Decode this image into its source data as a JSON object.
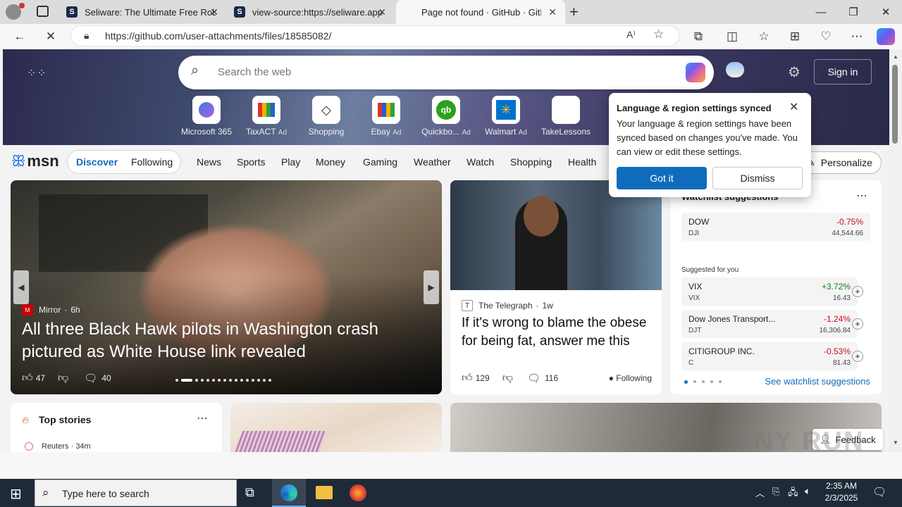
{
  "tabs": [
    {
      "title": "Seliware: The Ultimate Free Roblo",
      "favicon": "S"
    },
    {
      "title": "view-source:https://seliware.app",
      "favicon": "S"
    },
    {
      "title": "Page not found · GitHub · GitHub",
      "favicon": ""
    }
  ],
  "address": {
    "url": "https://github.com/user-attachments/files/18585082/"
  },
  "search": {
    "placeholder": "Search the web"
  },
  "signin": "Sign in",
  "quicklinks": [
    {
      "label": "Microsoft 365",
      "ad": "",
      "icon": "m365-icon"
    },
    {
      "label": "TaxACT",
      "ad": "Ad",
      "icon": "taxact-icon"
    },
    {
      "label": "Shopping",
      "ad": "",
      "icon": "tag-icon"
    },
    {
      "label": "Ebay",
      "ad": "Ad",
      "icon": "ebay-icon"
    },
    {
      "label": "Quickbo...",
      "ad": "Ad",
      "icon": "quickbooks-icon"
    },
    {
      "label": "Walmart",
      "ad": "Ad",
      "icon": "walmart-icon"
    },
    {
      "label": "TakeLessons",
      "ad": "",
      "icon": "takelessons-icon"
    }
  ],
  "nav": {
    "logo": "msn",
    "discover": "Discover",
    "following": "Following",
    "items": [
      "News",
      "Sports",
      "Play",
      "Money",
      "Gaming",
      "Weather",
      "Watch",
      "Shopping",
      "Health"
    ],
    "personalize": "Personalize"
  },
  "main_story": {
    "source": "Mirror",
    "age": "6h",
    "headline": "All three Black Hawk pilots in Washington crash pictured as White House link revealed",
    "likes": "47",
    "comments": "40"
  },
  "story2": {
    "source": "The Telegraph",
    "age": "1w",
    "headline": "If it's wrong to blame the obese for being fat, answer me this",
    "likes": "129",
    "comments": "116",
    "following": "Following"
  },
  "watchlist": {
    "title": "Watchlist suggestions",
    "top": {
      "name": "DOW",
      "sym": "DJI",
      "chg": "-0.75%",
      "val": "44,544.66"
    },
    "suggested_label": "Suggested for you",
    "items": [
      {
        "name": "VIX",
        "sym": "VIX",
        "chg": "+3.72%",
        "val": "16.43"
      },
      {
        "name": "Dow Jones Transport...",
        "sym": "DJT",
        "chg": "-1.24%",
        "val": "16,306.84"
      },
      {
        "name": "CITIGROUP INC.",
        "sym": "C",
        "chg": "-0.53%",
        "val": "81.43"
      }
    ],
    "see_more": "See watchlist suggestions"
  },
  "top_stories": {
    "title": "Top stories",
    "first_source": "Reuters",
    "first_age": "34m"
  },
  "feedback": "Feedback",
  "popup": {
    "title": "Language & region settings synced",
    "body": "Your language & region settings have been synced based on changes you've made. You can view or edit these settings.",
    "got_it": "Got it",
    "dismiss": "Dismiss"
  },
  "taskbar": {
    "search_placeholder": "Type here to search",
    "time": "2:35 AM",
    "date": "2/3/2025"
  },
  "watermark": "ANY RUN",
  "colors": {
    "accent": "#0f6cbd",
    "negative": "#c50f1f",
    "positive": "#107c10"
  }
}
